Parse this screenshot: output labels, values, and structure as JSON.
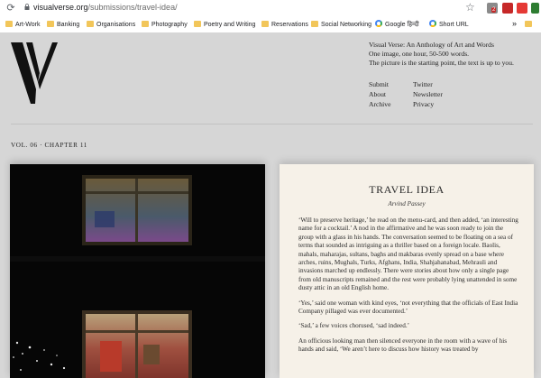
{
  "browser": {
    "url_host": "visualverse.org",
    "url_path": "/submissions/travel-idea/",
    "bookmarks": [
      {
        "label": "Art-Work",
        "type": "folder"
      },
      {
        "label": "Banking",
        "type": "folder"
      },
      {
        "label": "Organisations",
        "type": "folder"
      },
      {
        "label": "Photography",
        "type": "folder"
      },
      {
        "label": "Poetry and Writing",
        "type": "folder"
      },
      {
        "label": "Reservations",
        "type": "folder"
      },
      {
        "label": "Social Networking",
        "type": "folder"
      },
      {
        "label": "Google हिन्दी",
        "type": "google"
      },
      {
        "label": "Short URL",
        "type": "google"
      }
    ],
    "overflow": "»",
    "extension_badge": "2",
    "extension_colors": [
      "#7a7a7a",
      "#c62828",
      "#d32f2f",
      "#2e7d32"
    ]
  },
  "site": {
    "logo_alt": "V",
    "intro": [
      "Visual Verse: An Anthology of Art and Words",
      "One image, one hour, 50-500 words.",
      "The picture is the starting point, the text is up to you."
    ],
    "menu_left": [
      "Submit",
      "About",
      "Archive"
    ],
    "menu_right": [
      "Twitter",
      "Newsletter",
      "Privacy"
    ]
  },
  "issue": {
    "label": "VOL. 06 · CHAPTER 11"
  },
  "story": {
    "title": "TRAVEL IDEA",
    "author": "Arvind Passey",
    "paragraphs": [
      "‘Will to preserve heritage,’ he read on the menu-card, and then added, ‘an interesting name for a cocktail.’ A nod in the affirmative and he was soon ready to join the group with a glass in his hands. The conversation seemed to be floating on a sea of terms that sounded as intriguing as a thriller based on a foreign locale. Baolis, mahals, maharajas, sultans, baghs and makbaras evenly spread on a base where arches, ruins, Mughals, Turks, Afghans, India, Shahjahanabad, Mehrauli and invasions marched up endlessly. There were stories about how only a single page from old manuscripts remained and the rest were probably lying unattended in some dusty attic in an old English home.",
      "‘Yes,’ said one woman with kind eyes, ‘not everything that the officials of East India Company pillaged was ever documented.’",
      "‘Sad,’ a few voices chorused, ‘sad indeed.’",
      "An officious looking man then silenced everyone in the room with a wave of his hands and said, ‘We aren’t here to discuss how history was treated by"
    ]
  }
}
